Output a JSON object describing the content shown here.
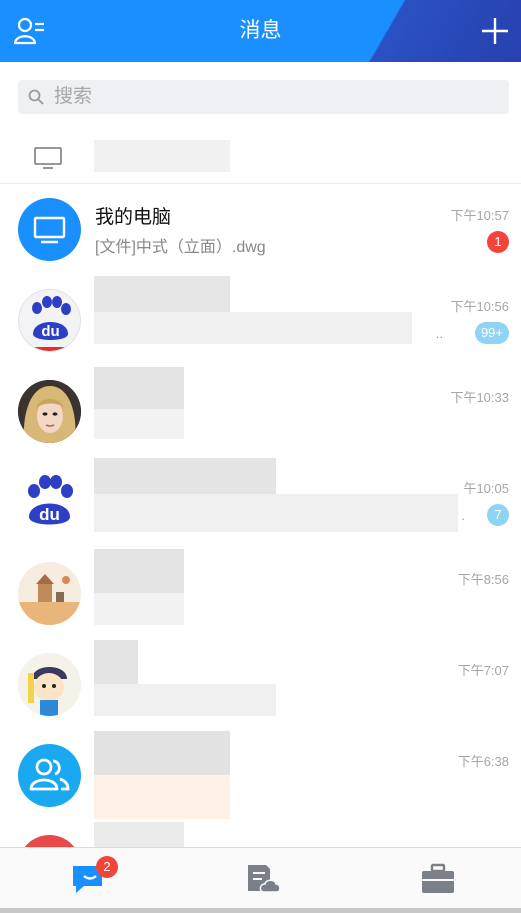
{
  "header": {
    "title": "消息",
    "left_icon": "contacts-icon",
    "right_icon": "plus-icon",
    "bg_color": "#1a8fff"
  },
  "search": {
    "placeholder": "搜索",
    "icon": "search-icon"
  },
  "device_row": {
    "icon": "monitor-icon"
  },
  "conversations": [
    {
      "name": "我的电脑",
      "preview": "[文件]中式（立面）.dwg",
      "time": "下午10:57",
      "badge": "1",
      "badge_color": "#f2443a",
      "avatar": "computer-avatar"
    },
    {
      "name": "",
      "preview": "",
      "time": "下午10:56",
      "badge": "99+",
      "badge_color": "#8fd3f5",
      "avatar": "baidu-avatar",
      "trailing": ".."
    },
    {
      "name": "",
      "preview": "",
      "time": "下午10:33",
      "badge": "",
      "avatar": "photo-avatar"
    },
    {
      "name": "",
      "preview": "",
      "time": "午10:05",
      "badge": "7",
      "badge_color": "#8fd3f5",
      "avatar": "baidu-avatar",
      "trailing": "."
    },
    {
      "name": "",
      "preview": "",
      "time": "下午8:56",
      "badge": "",
      "avatar": "illustration-avatar"
    },
    {
      "name": "",
      "preview": "",
      "time": "下午7:07",
      "badge": "",
      "avatar": "cartoon-avatar"
    },
    {
      "name": "",
      "preview": "",
      "time": "下午6:38",
      "badge": "",
      "avatar": "group-avatar"
    }
  ],
  "tabbar": {
    "tabs": [
      {
        "icon": "messages-icon",
        "badge": "2",
        "active": true,
        "color": "#1a8fff"
      },
      {
        "icon": "cloud-files-icon",
        "badge": "",
        "active": false,
        "color": "#7a7f88"
      },
      {
        "icon": "briefcase-icon",
        "badge": "",
        "active": false,
        "color": "#7a7f88"
      }
    ]
  }
}
